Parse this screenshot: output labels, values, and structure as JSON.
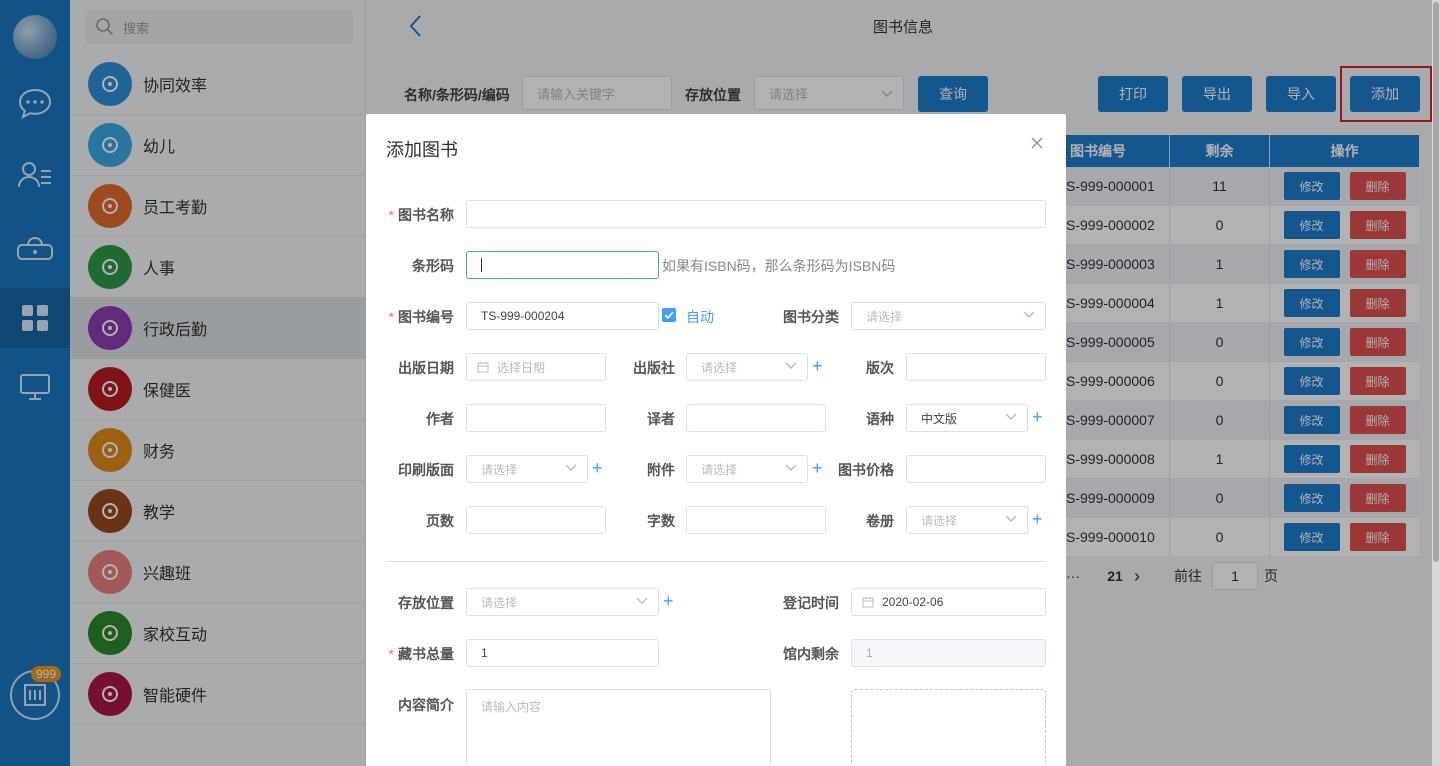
{
  "rail": {
    "badge": "999"
  },
  "search": {
    "placeholder": "搜索"
  },
  "apps": [
    {
      "label": "协同效率",
      "color": "#2f8fd8"
    },
    {
      "label": "幼儿",
      "color": "#3aa8e6"
    },
    {
      "label": "员工考勤",
      "color": "#e06a2c"
    },
    {
      "label": "人事",
      "color": "#2e9a4a"
    },
    {
      "label": "行政后勤",
      "color": "#8b3db0"
    },
    {
      "label": "保健医",
      "color": "#b81c22"
    },
    {
      "label": "财务",
      "color": "#e08a1a"
    },
    {
      "label": "教学",
      "color": "#9a4a20"
    },
    {
      "label": "兴趣班",
      "color": "#e88080"
    },
    {
      "label": "家校互动",
      "color": "#2a8a2a"
    },
    {
      "label": "智能硬件",
      "color": "#a8184a"
    }
  ],
  "page": {
    "title": "图书信息"
  },
  "filter": {
    "name_label": "名称/条形码/编码",
    "name_placeholder": "请输入关键字",
    "location_label": "存放位置",
    "location_placeholder": "请选择",
    "query_button": "查询"
  },
  "toolbar": {
    "print": "打印",
    "export": "导出",
    "import": "导入",
    "add": "添加"
  },
  "table": {
    "headers": [
      "图书编号",
      "剩余",
      "操作"
    ],
    "edit_label": "修改",
    "delete_label": "删除",
    "rows": [
      {
        "code": "S-999-000001",
        "remain": "11"
      },
      {
        "code": "S-999-000002",
        "remain": "0"
      },
      {
        "code": "S-999-000003",
        "remain": "1"
      },
      {
        "code": "S-999-000004",
        "remain": "1"
      },
      {
        "code": "S-999-000005",
        "remain": "0"
      },
      {
        "code": "S-999-000006",
        "remain": "0"
      },
      {
        "code": "S-999-000007",
        "remain": "0"
      },
      {
        "code": "S-999-000008",
        "remain": "1"
      },
      {
        "code": "S-999-000009",
        "remain": "0"
      },
      {
        "code": "S-999-000010",
        "remain": "0"
      }
    ]
  },
  "pager": {
    "ellipsis": "···",
    "last": "21",
    "next": "›",
    "goto": "前往",
    "page": "1",
    "suffix": "页"
  },
  "dialog": {
    "title": "添加图书",
    "book_name": {
      "label": "图书名称",
      "value": ""
    },
    "barcode": {
      "label": "条形码",
      "value": "",
      "hint": "如果有ISBN码，那么条形码为ISBN码"
    },
    "book_code": {
      "label": "图书编号",
      "value": "TS-999-000204",
      "auto": "自动"
    },
    "category": {
      "label": "图书分类",
      "placeholder": "请选择"
    },
    "pub_date": {
      "label": "出版日期",
      "placeholder": "选择日期"
    },
    "publisher": {
      "label": "出版社",
      "placeholder": "请选择"
    },
    "edition": {
      "label": "版次"
    },
    "author": {
      "label": "作者"
    },
    "translator": {
      "label": "译者"
    },
    "language": {
      "label": "语种",
      "value": "中文版"
    },
    "print_layout": {
      "label": "印刷版面",
      "placeholder": "请选择"
    },
    "attachment": {
      "label": "附件",
      "placeholder": "请选择"
    },
    "price": {
      "label": "图书价格"
    },
    "pages": {
      "label": "页数"
    },
    "words": {
      "label": "字数"
    },
    "volume": {
      "label": "卷册",
      "placeholder": "请选择"
    },
    "storage": {
      "label": "存放位置",
      "placeholder": "请选择"
    },
    "register_time": {
      "label": "登记时间",
      "value": "2020-02-06"
    },
    "total": {
      "label": "藏书总量",
      "value": "1"
    },
    "remaining": {
      "label": "馆内剩余",
      "value": "1"
    },
    "summary": {
      "label": "内容简介",
      "placeholder": "请输入内容"
    },
    "plus": "+"
  },
  "colors": {
    "primary": "#1e7bcc",
    "danger": "#e05050",
    "link": "#409eff",
    "rail": "#1a78c2"
  }
}
